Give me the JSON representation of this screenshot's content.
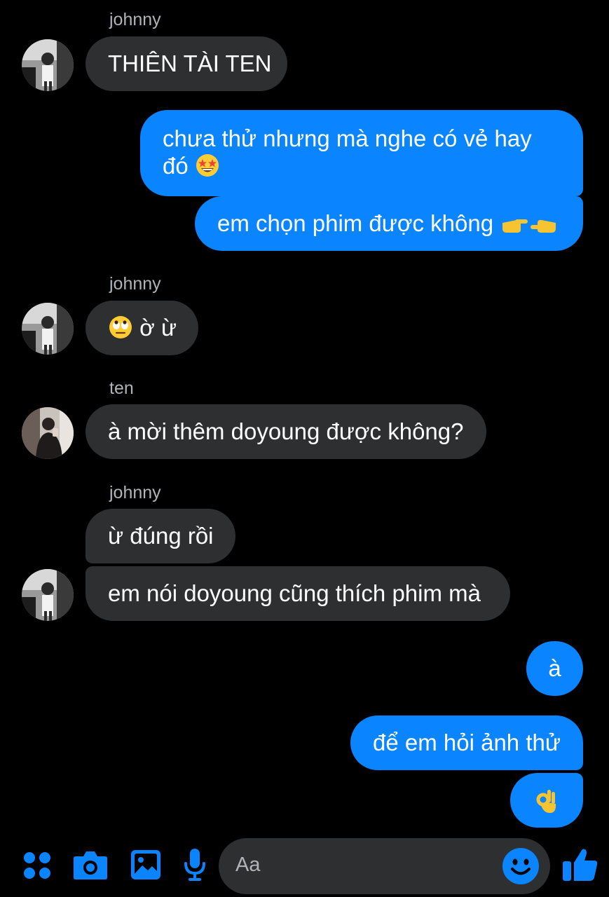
{
  "colors": {
    "background": "#000000",
    "incoming_bubble": "#2e2f31",
    "outgoing_bubble": "#0a84ff",
    "accent": "#0a84ff",
    "sender_text": "#b0b3b8"
  },
  "messages": [
    {
      "id": "m1",
      "direction": "incoming",
      "sender": "johnny",
      "text": "THIÊN TÀI TEN",
      "emoji": null,
      "avatar": "johnny"
    },
    {
      "id": "m2",
      "direction": "outgoing",
      "text": "chưa thử nhưng mà nghe có vẻ hay đó",
      "emoji": "star-struck-emoji"
    },
    {
      "id": "m3",
      "direction": "outgoing",
      "text": "em chọn phim được không",
      "emoji": "pointing-fingers-emoji"
    },
    {
      "id": "m4",
      "direction": "incoming",
      "sender": "johnny",
      "text": "ờ ừ",
      "emoji": "rolling-eyes-emoji",
      "avatar": "johnny"
    },
    {
      "id": "m5",
      "direction": "incoming",
      "sender": "ten",
      "text": "à mời thêm doyoung được không?",
      "emoji": null,
      "avatar": "ten"
    },
    {
      "id": "m6",
      "direction": "incoming",
      "sender": "johnny",
      "text": "ừ đúng rồi",
      "emoji": null
    },
    {
      "id": "m7",
      "direction": "incoming",
      "text": "em nói doyoung cũng thích phim mà",
      "emoji": null,
      "avatar": "johnny"
    },
    {
      "id": "m8",
      "direction": "outgoing",
      "text": "à",
      "emoji": null
    },
    {
      "id": "m9",
      "direction": "outgoing",
      "text": "để em hỏi ảnh thử",
      "emoji": null
    },
    {
      "id": "m10",
      "direction": "outgoing",
      "text": "",
      "emoji": "ok-hand-emoji"
    }
  ],
  "composer": {
    "placeholder": "Aa",
    "icons": [
      "apps-grid-icon",
      "camera-icon",
      "gallery-icon",
      "microphone-icon",
      "emoji-smiley-icon",
      "thumbs-up-icon"
    ]
  }
}
